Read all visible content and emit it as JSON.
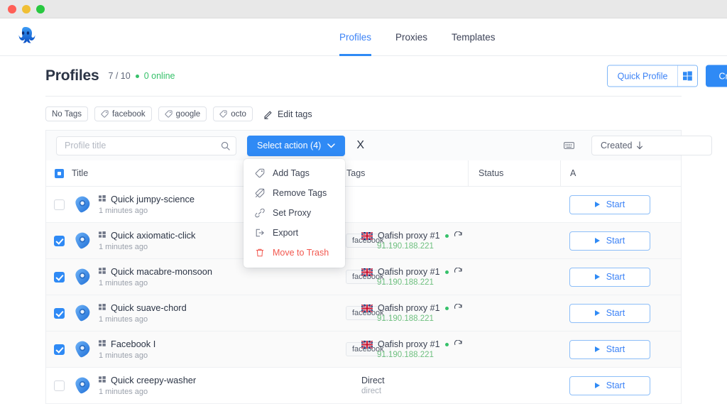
{
  "window": {
    "traffic_lights": [
      "close",
      "minimize",
      "maximize"
    ]
  },
  "header": {
    "logo_name": "octo-browser-logo",
    "nav": [
      {
        "label": "Profiles",
        "active": true
      },
      {
        "label": "Proxies",
        "active": false
      },
      {
        "label": "Templates",
        "active": false
      }
    ]
  },
  "page": {
    "title": "Profiles",
    "count": "7 / 10",
    "online": "0 online",
    "quick_profile_label": "Quick Profile",
    "quick_profile_os_icon": "windows-icon",
    "create_label": "Create"
  },
  "tag_filters": [
    {
      "label": "No Tags",
      "icon": null
    },
    {
      "label": "facebook",
      "icon": "tag-icon"
    },
    {
      "label": "google",
      "icon": "tag-icon"
    },
    {
      "label": "octo",
      "icon": "tag-icon"
    }
  ],
  "edit_tags": {
    "label": "Edit tags",
    "icon": "pencil-icon"
  },
  "toolbar": {
    "search_placeholder": "Profile title",
    "search_value": "",
    "search_icon": "search-icon",
    "select_action_label": "Select action (4)",
    "chevron_icon": "chevron-down-icon",
    "clear_label": "X",
    "keyboard_icon": "keyboard-icon",
    "sort_label": "Created",
    "sort_direction_icon": "arrow-down-icon"
  },
  "dropdown": {
    "open": true,
    "items": [
      {
        "label": "Add Tags",
        "icon": "tag-icon",
        "danger": false
      },
      {
        "label": "Remove Tags",
        "icon": "tag-off-icon",
        "danger": false
      },
      {
        "label": "Set Proxy",
        "icon": "link-icon",
        "danger": false
      },
      {
        "label": "Export",
        "icon": "export-icon",
        "danger": false
      },
      {
        "label": "Move to Trash",
        "icon": "trash-icon",
        "danger": true
      }
    ]
  },
  "table": {
    "select_all_state": "indeterminate",
    "columns": [
      {
        "key": "title",
        "label": "Title"
      },
      {
        "key": "tags",
        "label": "Tags"
      },
      {
        "key": "status",
        "label": "Status"
      },
      {
        "key": "actions",
        "label": "A"
      }
    ],
    "rows": [
      {
        "checked": false,
        "icon": "profile-avatar-icon",
        "grid_icon": "grid-dots-icon",
        "title": "Quick jumpy-science",
        "time": "1 minutes ago",
        "proxy": null,
        "tags": [],
        "status": "",
        "action_label": "Start",
        "action_icon": "play-icon"
      },
      {
        "checked": true,
        "icon": "profile-avatar-icon",
        "grid_icon": "grid-dots-icon",
        "title": "Quick axiomatic-click",
        "time": "1 minutes ago",
        "proxy": {
          "flag": "gb",
          "name": "Oafish proxy #1",
          "online": true,
          "refresh_icon": "refresh-icon",
          "ip": "91.190.188.221"
        },
        "tags": [
          "facebook"
        ],
        "status": "",
        "action_label": "Start",
        "action_icon": "play-icon"
      },
      {
        "checked": true,
        "icon": "profile-avatar-icon",
        "grid_icon": "grid-dots-icon",
        "title": "Quick macabre-monsoon",
        "time": "1 minutes ago",
        "proxy": {
          "flag": "gb",
          "name": "Oafish proxy #1",
          "online": true,
          "refresh_icon": "refresh-icon",
          "ip": "91.190.188.221"
        },
        "tags": [
          "facebook"
        ],
        "status": "",
        "action_label": "Start",
        "action_icon": "play-icon"
      },
      {
        "checked": true,
        "icon": "profile-avatar-icon",
        "grid_icon": "grid-dots-icon",
        "title": "Quick suave-chord",
        "time": "1 minutes ago",
        "proxy": {
          "flag": "gb",
          "name": "Oafish proxy #1",
          "online": true,
          "refresh_icon": "refresh-icon",
          "ip": "91.190.188.221"
        },
        "tags": [
          "facebook"
        ],
        "status": "",
        "action_label": "Start",
        "action_icon": "play-icon"
      },
      {
        "checked": true,
        "icon": "profile-avatar-icon",
        "grid_icon": "grid-dots-icon",
        "title": "Facebook I",
        "time": "1 minutes ago",
        "proxy": {
          "flag": "gb",
          "name": "Oafish proxy #1",
          "online": true,
          "refresh_icon": "refresh-icon",
          "ip": "91.190.188.221"
        },
        "tags": [
          "facebook"
        ],
        "status": "",
        "action_label": "Start",
        "action_icon": "play-icon"
      },
      {
        "checked": false,
        "icon": "profile-avatar-icon",
        "grid_icon": "grid-dots-icon",
        "title": "Quick creepy-washer",
        "time": "1 minutes ago",
        "proxy": {
          "flag": null,
          "name": "Direct",
          "online": false,
          "refresh_icon": null,
          "ip": "direct"
        },
        "tags": [],
        "status": "",
        "action_label": "Start",
        "action_icon": "play-icon"
      }
    ]
  },
  "colors": {
    "accent": "#2f8af5",
    "danger": "#f2584f",
    "online": "#36c16a",
    "ip_green": "#6ec07f"
  }
}
